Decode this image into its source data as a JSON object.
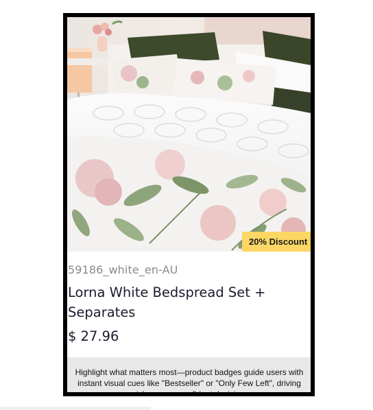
{
  "card": {
    "image_alt": "Lorna White Bedspread Set + Separates",
    "badge": "20% Discount",
    "sku": "59186_white_en-AU",
    "title": "Lorna White Bedspread Set + Separates",
    "price": "$ 27.96",
    "note": "Highlight what matters most—product badges guide users with instant visual cues like \"Bestseller\" or \"Only Few Left\", driving quicker, more confident decisions."
  },
  "colors": {
    "frame": "#000000",
    "badge_bg": "#fcd765",
    "title_text": "#1b1b2e",
    "sku_text": "#8a8a8a",
    "note_bg": "#e8e8e8"
  }
}
